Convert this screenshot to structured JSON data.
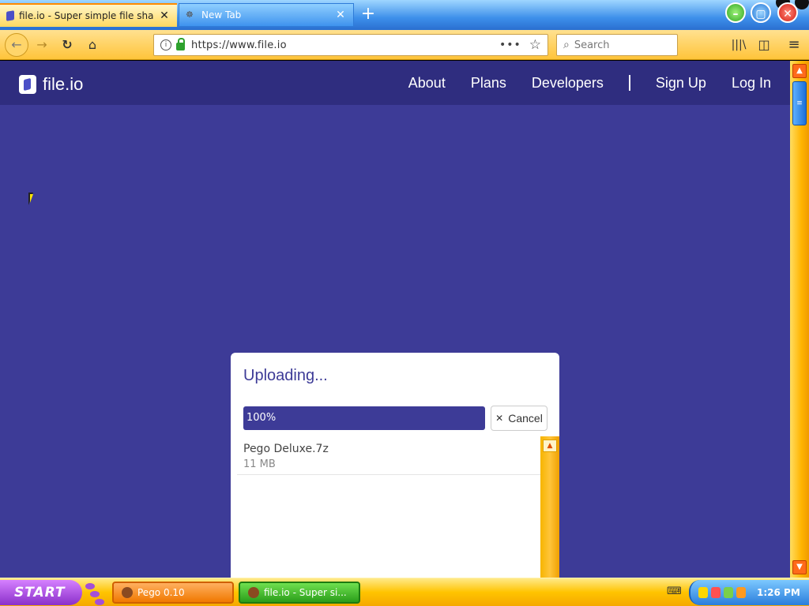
{
  "browser": {
    "tabs": [
      {
        "title": "file.io - Super simple file sha",
        "active": true
      },
      {
        "title": "New Tab",
        "active": false
      }
    ],
    "url": "https://www.file.io",
    "search_placeholder": "Search"
  },
  "site": {
    "logo_text": "file.io",
    "nav": [
      {
        "label": "About"
      },
      {
        "label": "Plans"
      },
      {
        "label": "Developers"
      },
      {
        "label": "Sign Up"
      },
      {
        "label": "Log In"
      }
    ]
  },
  "upload": {
    "title": "Uploading...",
    "progress_label": "100%",
    "progress_value": 100,
    "cancel_label": "Cancel",
    "files": [
      {
        "name": "Pego Deluxe.7z",
        "size": "11 MB"
      }
    ]
  },
  "taskbar": {
    "start_label": "START",
    "tasks": [
      {
        "label": "Pego 0.10"
      },
      {
        "label": "file.io - Super si..."
      }
    ],
    "clock": "1:26 PM"
  },
  "colors": {
    "page_bg": "#3d3b97",
    "header_bg": "#2f2d7f",
    "toolbar": "#ffc43a"
  }
}
